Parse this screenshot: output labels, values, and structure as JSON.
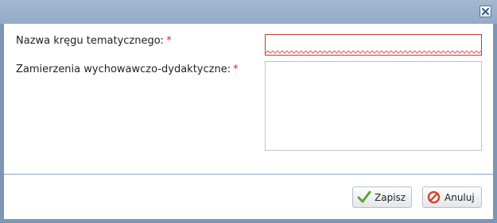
{
  "form": {
    "name_label": "Nazwa kręgu tematycznego:",
    "name_required": "*",
    "name_value": "",
    "goals_label": "Zamierzenia wychowawczo-dydaktyczne:",
    "goals_required": "*",
    "goals_value": ""
  },
  "buttons": {
    "save_label": "Zapisz",
    "cancel_label": "Anuluj"
  },
  "icons": {
    "close": "close-icon",
    "save": "checkmark-icon",
    "cancel": "cancel-icon"
  },
  "colors": {
    "required_mark": "#e02020",
    "invalid_border": "#c0392b"
  }
}
